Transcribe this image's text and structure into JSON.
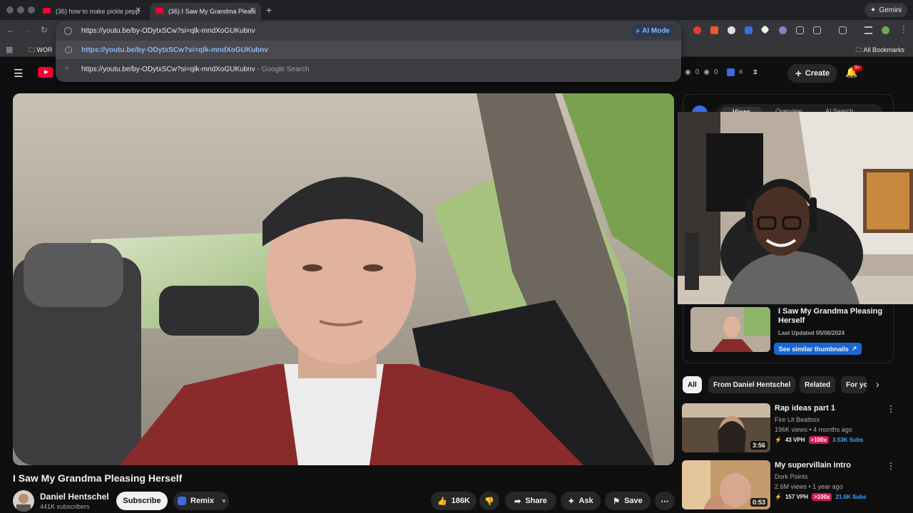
{
  "browser": {
    "tabs": [
      {
        "title": "(36) how to make pickle pepp",
        "active": false
      },
      {
        "title": "(36) I Saw My Grandma Pleasi",
        "active": true
      }
    ],
    "gemini_label": "Gemini",
    "omnibox": {
      "url": "https://youtu.be/by-ODytxSCw?si=qlk-mndXoGUKubnv",
      "ai_mode_label": "AI Mode",
      "suggestions": [
        {
          "text": "https://youtu.be/by-ODytxSCw?si=qlk-mndXoGUKubnv",
          "suffix": ""
        },
        {
          "text": "https://youtu.be/by-ODytxSCw?si=qlk-mndXoGUKubnv",
          "suffix": "- Google Search"
        }
      ]
    },
    "bookmarks": {
      "folder": "WOR",
      "all_bookmarks": "All Bookmarks"
    }
  },
  "youtube": {
    "header": {
      "ext_counts": [
        "0",
        "0"
      ],
      "create_label": "Create",
      "notif_count": "9+"
    },
    "video": {
      "title": "I Saw My Grandma Pleasing Herself",
      "channel": "Daniel Hentschel",
      "subscribers": "441K subscribers",
      "subscribe_label": "Subscribe",
      "remix_label": "Remix",
      "likes": "186K",
      "share_label": "Share",
      "ask_label": "Ask",
      "save_label": "Save"
    },
    "ext_panel": {
      "tabs": [
        "Views",
        "Overview",
        "AI Search"
      ],
      "card_title": "I Saw My Grandma Pleasing Herself",
      "last_updated": "Last Updated 05/06/2024",
      "see_similar": "See similar thumbnails"
    },
    "chips": [
      "All",
      "From Daniel Hentschel",
      "Related",
      "For yo"
    ],
    "recommendations": [
      {
        "title": "Rap ideas part 1",
        "channel": "Fire Lit Beatbox",
        "meta": "196K views • 4 months ago",
        "duration": "3:56",
        "vph": "43 VPH",
        "outlier": ">100x",
        "subs": "3.53K Subs"
      },
      {
        "title": "My supervillain intro",
        "channel": "Dork Points",
        "meta": "2.6M views • 1 year ago",
        "duration": "0:53",
        "vph": "157 VPH",
        "outlier": ">100x",
        "subs": "21.6K Subs"
      }
    ]
  }
}
